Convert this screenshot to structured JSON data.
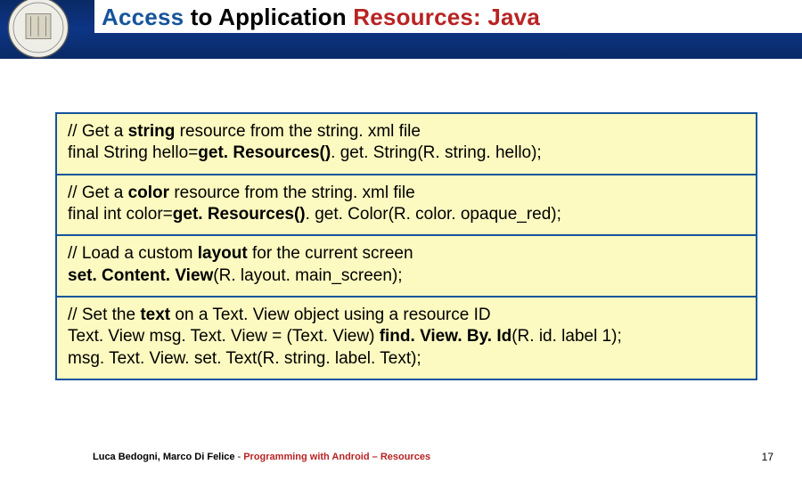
{
  "title": {
    "w1": "Access ",
    "w2": "to ",
    "w3": "Application ",
    "w4": "Resources: ",
    "w5": "Java"
  },
  "blocks": {
    "b1": {
      "c1a": "// Get a ",
      "c1b": "string",
      "c1c": " resource from the string. xml file",
      "l2a": "final String hello=",
      "l2b": "get. Resources()",
      "l2c": ". get. String(R. string. hello);"
    },
    "b2": {
      "c1a": "// Get a ",
      "c1b": "color",
      "c1c": " resource from the string. xml file",
      "l2a": "final int color=",
      "l2b": "get. Resources()",
      "l2c": ". get. Color(R. color. opaque_red);"
    },
    "b3": {
      "c1a": "// Load a custom ",
      "c1b": "layout",
      "c1c": " for the current screen",
      "l2a": "set. Content. View",
      "l2b": "(R. layout. main_screen);"
    },
    "b4": {
      "c1a": "// Set the ",
      "c1b": "text",
      "c1c": " on a Text. View object using a resource ID",
      "l2": "Text. View msg. Text. View = (Text. View) ",
      "l2b": "find. View. By. Id",
      "l2c": "(R. id. label 1);",
      "l3": "msg. Text. View. set. Text(R. string. label. Text);"
    }
  },
  "footer": {
    "authors": "Luca Bedogni, Marco Di Felice",
    "sep": " - ",
    "topic": "Programming with Android – Resources",
    "page": "17"
  }
}
